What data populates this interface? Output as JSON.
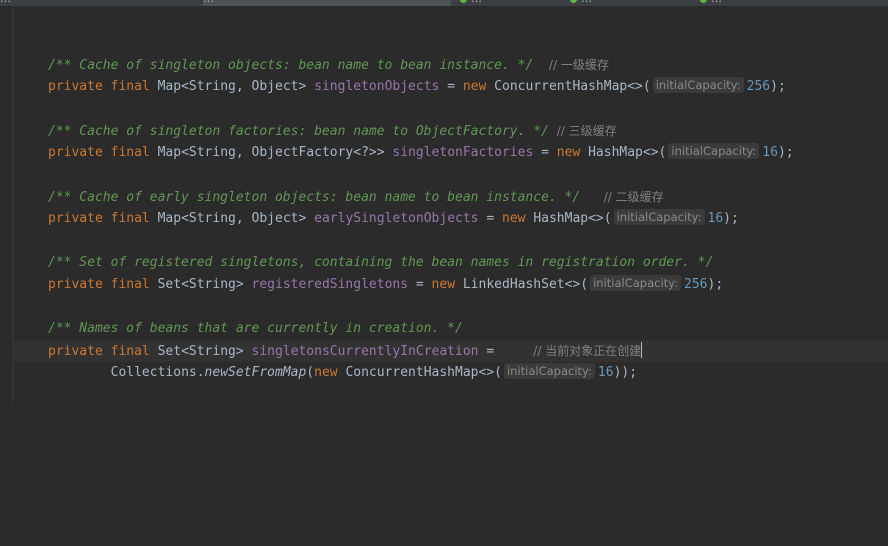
{
  "tabs": [
    {
      "label": "…"
    },
    {
      "label": "…",
      "active": true
    },
    {
      "label": "…"
    },
    {
      "label": "…"
    },
    {
      "label": "…"
    }
  ],
  "code": {
    "comment_singleton_objects": "/** Cache of singleton objects: bean name to bean instance. */",
    "cn_level1": "// 一级缓存",
    "comment_singleton_factories": "/** Cache of singleton factories: bean name to ObjectFactory. */",
    "cn_level3": "// 三级缓存",
    "comment_early_singleton_objects": "/** Cache of early singleton objects: bean name to bean instance. */",
    "cn_level2": "// 二级缓存",
    "comment_registered_singletons": "/** Set of registered singletons, containing the bean names in registration order. */",
    "comment_currently_in_creation": "/** Names of beans that are currently in creation. */",
    "cn_in_creation": "// 当前对象正在创建",
    "kw_private": "private",
    "kw_final": "final",
    "kw_new": "new",
    "type_map_string_object": "Map<String, Object>",
    "type_map_string_objectfactory": "Map<String, ObjectFactory<?>>",
    "type_set_string": "Set<String>",
    "field_singleton_objects": "singletonObjects",
    "field_singleton_factories": "singletonFactories",
    "field_early_singleton_objects": "earlySingletonObjects",
    "field_registered_singletons": "registeredSingletons",
    "field_singletons_currently_in_creation": "singletonsCurrentlyInCreation",
    "ctor_concurrent_hash_map": "ConcurrentHashMap<>(",
    "ctor_hash_map": "HashMap<>(",
    "ctor_linked_hash_set": "LinkedHashSet<>(",
    "collections_class": "Collections.",
    "method_new_set_from_map": "newSetFromMap",
    "param_hint": "initialCapacity:",
    "value_256": "256",
    "value_16": "16"
  },
  "colors": {
    "background": "#2b2b2b",
    "keyword": "#cc7832",
    "field": "#9876aa",
    "number": "#6897bb",
    "doc_comment": "#629755",
    "line_comment": "#808080",
    "text": "#a9b7c6"
  }
}
